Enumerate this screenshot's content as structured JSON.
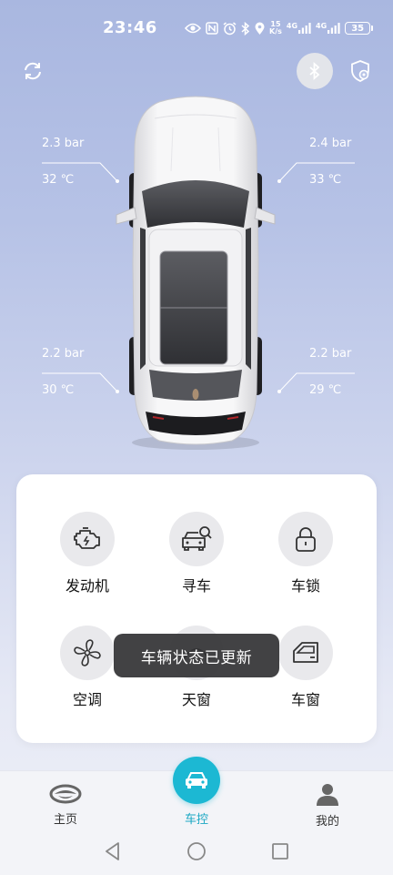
{
  "status_bar": {
    "time": "23:46",
    "net_speed_value": "15",
    "net_speed_unit": "K/s",
    "net_type_1": "4G",
    "net_type_2": "4G",
    "battery": "35"
  },
  "tires": {
    "front_left": {
      "pressure": "2.3 bar",
      "temp": "32 ℃"
    },
    "front_right": {
      "pressure": "2.4 bar",
      "temp": "33 ℃"
    },
    "rear_left": {
      "pressure": "2.2 bar",
      "temp": "30 ℃"
    },
    "rear_right": {
      "pressure": "2.2 bar",
      "temp": "29 ℃"
    }
  },
  "controls": [
    {
      "label": "发动机",
      "icon": "engine-icon"
    },
    {
      "label": "寻车",
      "icon": "find-car-icon"
    },
    {
      "label": "车锁",
      "icon": "lock-icon"
    },
    {
      "label": "空调",
      "icon": "fan-icon"
    },
    {
      "label": "天窗",
      "icon": "sunroof-icon"
    },
    {
      "label": "车窗",
      "icon": "car-window-icon"
    }
  ],
  "toast": "车辆状态已更新",
  "nav": {
    "home": "主页",
    "control": "车控",
    "mine": "我的"
  },
  "colors": {
    "accent": "#1cb8d3",
    "control_bg": "#e9e9ec"
  }
}
